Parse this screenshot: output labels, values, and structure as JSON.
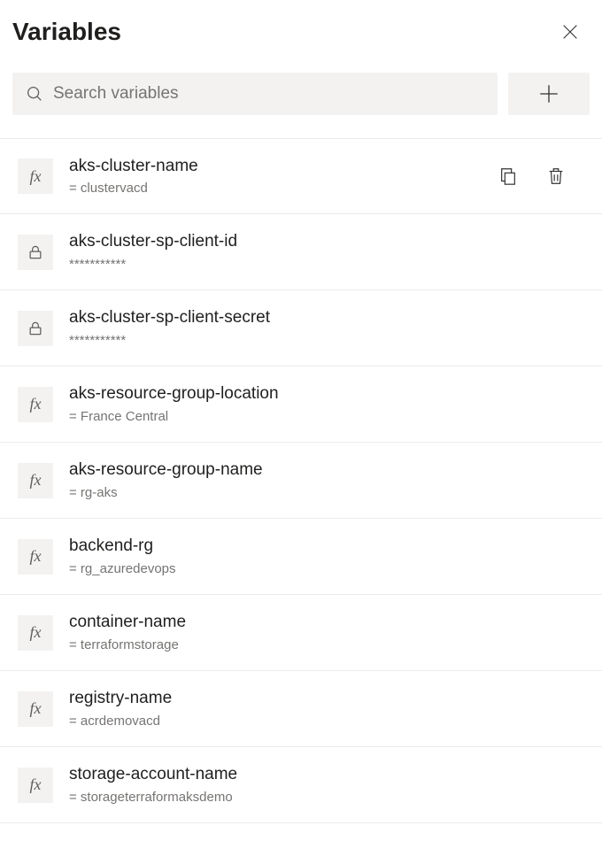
{
  "header": {
    "title": "Variables"
  },
  "search": {
    "placeholder": "Search variables",
    "value": ""
  },
  "variables": [
    {
      "name": "aks-cluster-name",
      "value": "= clustervacd",
      "type": "fx",
      "selected": true
    },
    {
      "name": "aks-cluster-sp-client-id",
      "value": "***********",
      "type": "lock",
      "selected": false
    },
    {
      "name": "aks-cluster-sp-client-secret",
      "value": "***********",
      "type": "lock",
      "selected": false
    },
    {
      "name": "aks-resource-group-location",
      "value": "= France Central",
      "type": "fx",
      "selected": false
    },
    {
      "name": "aks-resource-group-name",
      "value": "= rg-aks",
      "type": "fx",
      "selected": false
    },
    {
      "name": "backend-rg",
      "value": "= rg_azuredevops",
      "type": "fx",
      "selected": false
    },
    {
      "name": "container-name",
      "value": "= terraformstorage",
      "type": "fx",
      "selected": false
    },
    {
      "name": "registry-name",
      "value": "= acrdemovacd",
      "type": "fx",
      "selected": false
    },
    {
      "name": "storage-account-name",
      "value": "= storageterraformaksdemo",
      "type": "fx",
      "selected": false
    }
  ]
}
